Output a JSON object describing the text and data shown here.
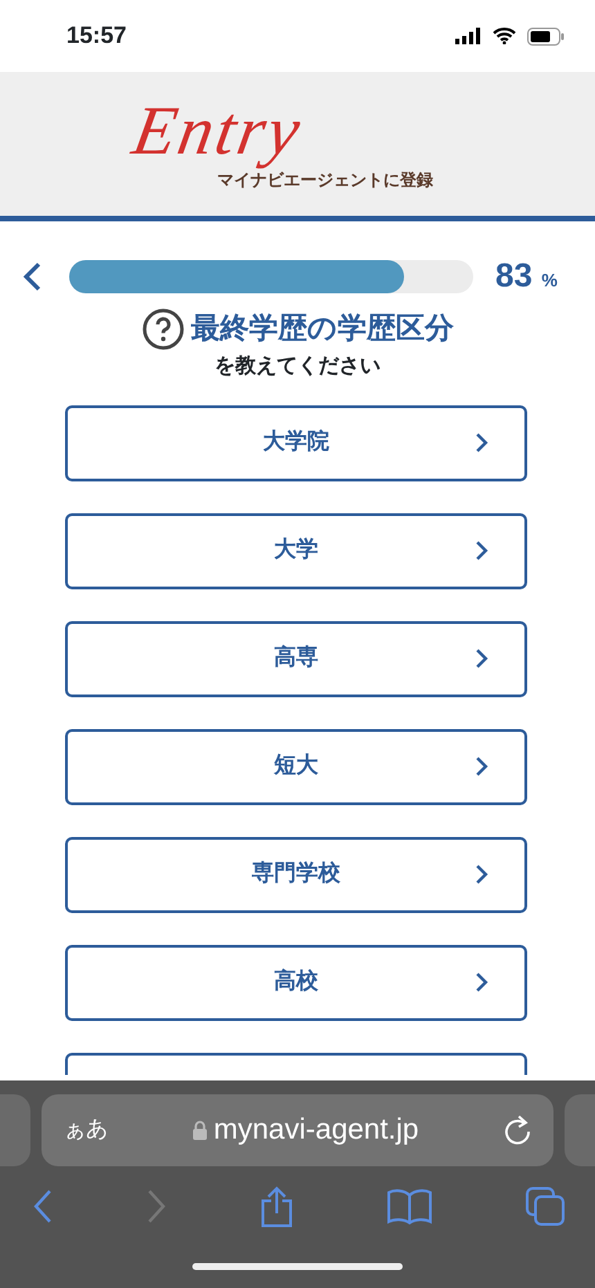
{
  "status_bar": {
    "time": "15:57"
  },
  "header": {
    "logo": "Entry",
    "tagline": "マイナビエージェントに登録"
  },
  "progress": {
    "level": 0.83,
    "value": "83",
    "unit": "%"
  },
  "question": {
    "title": "最終学歴の学歴区分",
    "subtitle": "を教えてください"
  },
  "options": [
    {
      "kind": "option",
      "label": "大学院"
    },
    {
      "kind": "option",
      "label": "大学"
    },
    {
      "kind": "option",
      "label": "高専"
    },
    {
      "kind": "option",
      "label": "短大"
    },
    {
      "kind": "option",
      "label": "専門学校"
    },
    {
      "kind": "option",
      "label": "高校"
    },
    {
      "kind": "cut"
    }
  ],
  "browser": {
    "text_size": "ぁあ",
    "url": "mynavi-agent.jp",
    "forward_disabled": true
  }
}
